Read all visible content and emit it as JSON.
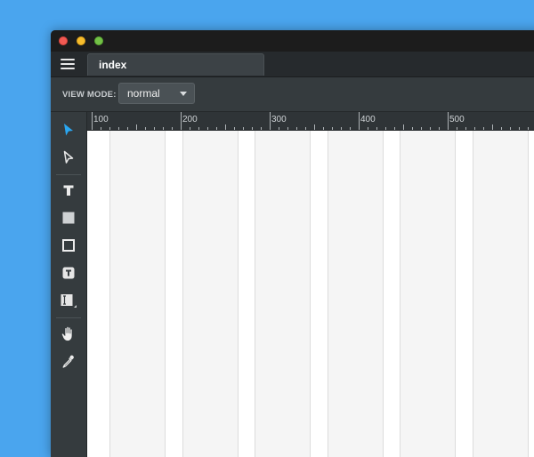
{
  "window": {
    "tab_label": "index"
  },
  "toolbar": {
    "view_mode_label": "VIEW MODE:",
    "view_mode_value": "normal"
  },
  "tools": [
    {
      "name": "select-tool",
      "icon": "arrow-pointer-icon",
      "active": true
    },
    {
      "name": "direct-select-tool",
      "icon": "hollow-arrow-icon"
    },
    {
      "name": "text-tool",
      "icon": "text-icon"
    },
    {
      "name": "filled-rectangle-tool",
      "icon": "filled-rectangle-icon"
    },
    {
      "name": "outline-rectangle-tool",
      "icon": "outline-rectangle-icon"
    },
    {
      "name": "text-box-tool",
      "icon": "text-box-icon"
    },
    {
      "name": "input-field-tool",
      "icon": "input-field-icon"
    },
    {
      "name": "hand-tool",
      "icon": "hand-icon"
    },
    {
      "name": "eyedropper-tool",
      "icon": "eyedropper-icon"
    }
  ],
  "ruler": {
    "labels": [
      "100",
      "200",
      "300",
      "400",
      "500"
    ]
  },
  "colors": {
    "desktop": "#4aa5ee",
    "accent": "#2aa6f0",
    "window_bg": "#2b3033"
  }
}
